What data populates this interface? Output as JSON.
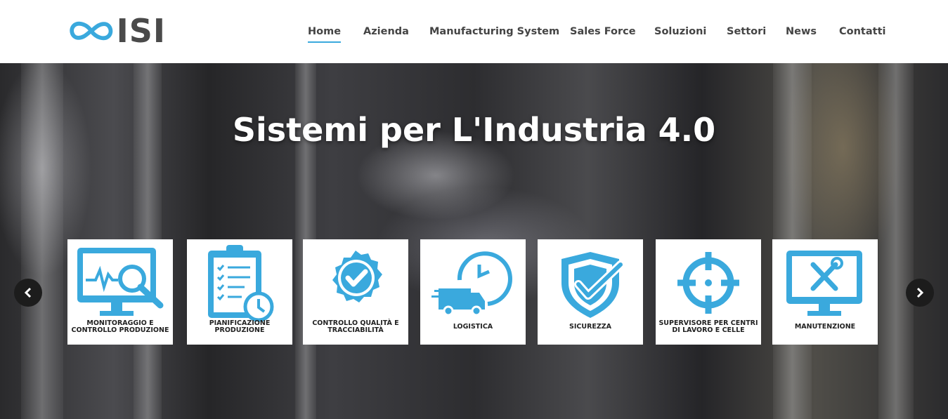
{
  "brand": {
    "name": "ISI",
    "logo_icon": "infinity-icon",
    "accent": "#3aa9dd"
  },
  "nav": {
    "items": [
      {
        "label": "Home",
        "active": true
      },
      {
        "label": "Azienda"
      },
      {
        "label": "Manufacturing System"
      },
      {
        "label": "Sales Force"
      },
      {
        "label": "Soluzioni"
      },
      {
        "label": "Settori"
      },
      {
        "label": "News"
      },
      {
        "label": "Contatti"
      }
    ]
  },
  "hero": {
    "title": "Sistemi per L'Industria 4.0",
    "tiles": [
      {
        "icon": "monitor-search-icon",
        "label": "MONITORAGGIO E CONTROLLO PRODUZIONE"
      },
      {
        "icon": "clipboard-clock-icon",
        "label": "PIANIFICAZIONE PRODUZIONE"
      },
      {
        "icon": "badge-check-icon",
        "label": "CONTROLLO QUALITÀ E TRACCIABILITÀ"
      },
      {
        "icon": "truck-clock-icon",
        "label": "LOGISTICA"
      },
      {
        "icon": "shield-check-icon",
        "label": "SICUREZZA"
      },
      {
        "icon": "crosshair-icon",
        "label": "SUPERVISORE PER CENTRI DI LAVORO E CELLE"
      },
      {
        "icon": "monitor-tools-icon",
        "label": "MANUTENZIONE"
      }
    ],
    "prev_icon": "chevron-left-icon",
    "next_icon": "chevron-right-icon"
  }
}
